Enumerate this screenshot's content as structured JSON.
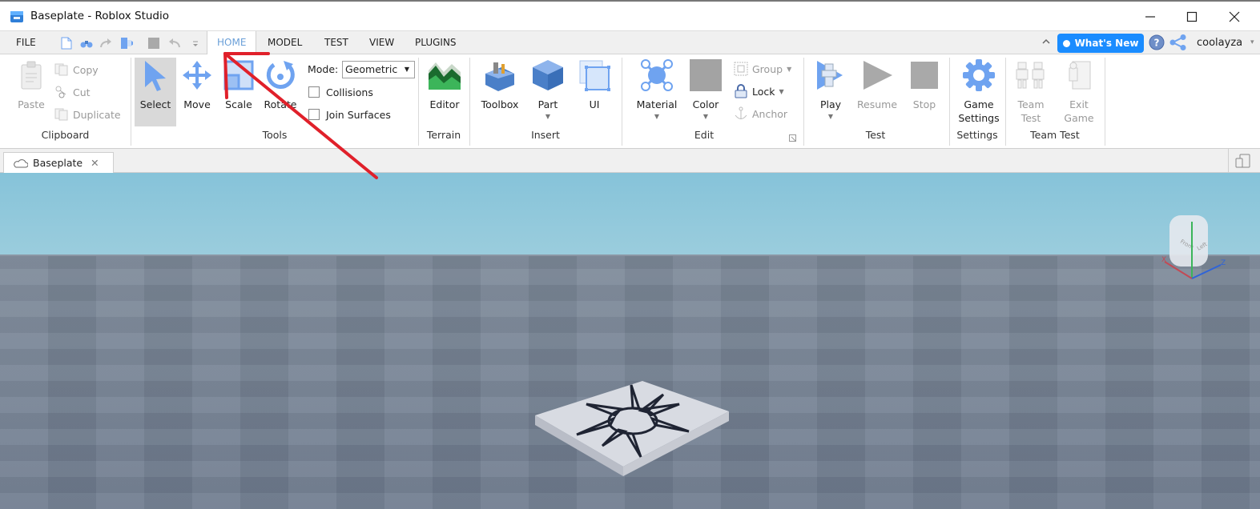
{
  "window": {
    "title": "Baseplate - Roblox Studio",
    "controls": {
      "minimize": "—",
      "maximize": "☐",
      "close": "✕"
    }
  },
  "menu": {
    "file_label": "FILE",
    "quick_access_icons": [
      "new-file-icon",
      "find-icon",
      "redo-icon",
      "publish-icon",
      "stop-icon",
      "undo-icon",
      "customize-icon"
    ],
    "tabs": [
      {
        "label": "HOME",
        "active": true
      },
      {
        "label": "MODEL",
        "active": false
      },
      {
        "label": "TEST",
        "active": false
      },
      {
        "label": "VIEW",
        "active": false
      },
      {
        "label": "PLUGINS",
        "active": false
      }
    ],
    "collapse_glyph": "⌃",
    "whats_new_label": "What's New",
    "username": "coolayza",
    "user_caret": "▾"
  },
  "ribbon": {
    "clipboard": {
      "label": "Clipboard",
      "paste": "Paste",
      "copy": "Copy",
      "cut": "Cut",
      "duplicate": "Duplicate"
    },
    "tools": {
      "label": "Tools",
      "select": "Select",
      "move": "Move",
      "scale": "Scale",
      "rotate": "Rotate",
      "mode_label": "Mode:",
      "mode_value": "Geometric",
      "collisions": {
        "label": "Collisions",
        "checked": false
      },
      "join_surfaces": {
        "label": "Join Surfaces",
        "checked": false
      }
    },
    "terrain": {
      "label": "Terrain",
      "editor": "Editor"
    },
    "insert": {
      "label": "Insert",
      "toolbox": "Toolbox",
      "part": "Part",
      "ui": "UI"
    },
    "edit": {
      "label": "Edit",
      "material": "Material",
      "color": "Color",
      "group": "Group",
      "lock": "Lock",
      "anchor": "Anchor"
    },
    "test": {
      "label": "Test",
      "play": "Play",
      "resume": "Resume",
      "stop": "Stop"
    },
    "settings": {
      "label": "Settings",
      "game_settings": "Game Settings"
    },
    "team_test": {
      "label": "Team Test",
      "team_test": "Team Test",
      "exit_game": "Exit Game"
    }
  },
  "document_tabs": [
    {
      "label": "Baseplate",
      "close": "✕"
    }
  ],
  "colors": {
    "accent": "#1a8cff",
    "active_tab_text": "#6a9fd8",
    "annotation_arrow": "#e0202a",
    "icon_blue": "#6fa3f0"
  }
}
